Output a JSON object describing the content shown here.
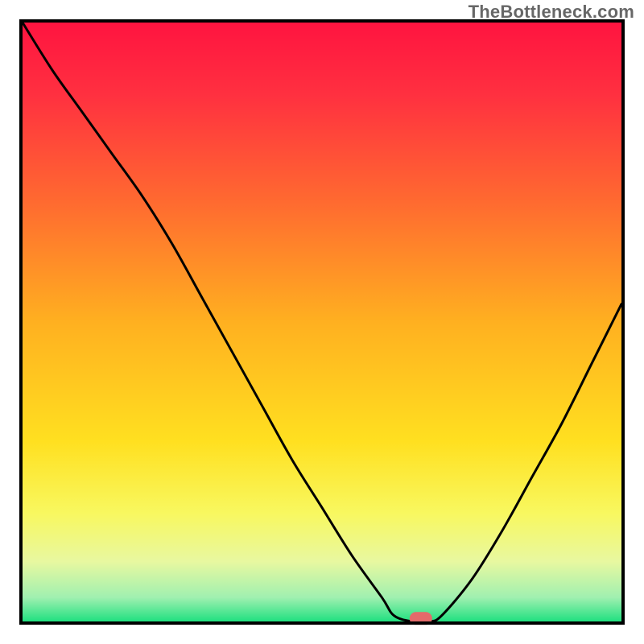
{
  "watermark": "TheBottleneck.com",
  "chart_data": {
    "type": "line",
    "title": "",
    "xlabel": "",
    "ylabel": "",
    "xlim": [
      0,
      100
    ],
    "ylim": [
      0,
      100
    ],
    "x": [
      0,
      5,
      10,
      15,
      20,
      25,
      30,
      35,
      40,
      45,
      50,
      55,
      60,
      62,
      65,
      68,
      70,
      75,
      80,
      85,
      90,
      95,
      100
    ],
    "values": [
      100,
      92,
      85,
      78,
      71,
      63,
      54,
      45,
      36,
      27,
      19,
      11,
      4,
      1,
      0,
      0,
      1,
      7,
      15,
      24,
      33,
      43,
      53
    ],
    "marker": {
      "x": 66.5,
      "y": 0.5,
      "color": "#e46a6a"
    },
    "gradient_stops": [
      {
        "offset": 0.0,
        "color": "#ff1440"
      },
      {
        "offset": 0.12,
        "color": "#ff3040"
      },
      {
        "offset": 0.3,
        "color": "#ff6a30"
      },
      {
        "offset": 0.5,
        "color": "#ffb020"
      },
      {
        "offset": 0.7,
        "color": "#ffe020"
      },
      {
        "offset": 0.82,
        "color": "#f8f860"
      },
      {
        "offset": 0.9,
        "color": "#e8f8a0"
      },
      {
        "offset": 0.96,
        "color": "#a0f0b0"
      },
      {
        "offset": 1.0,
        "color": "#20e080"
      }
    ]
  }
}
